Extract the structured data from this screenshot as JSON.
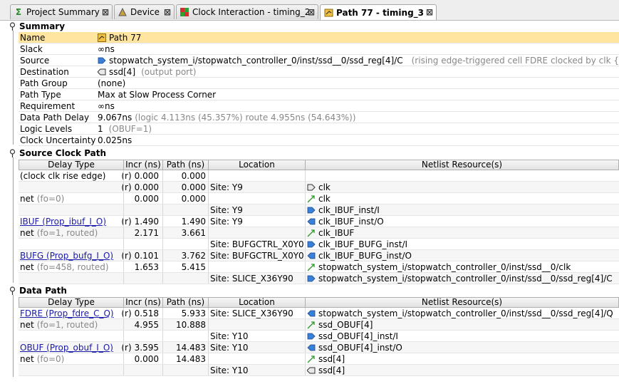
{
  "tabs": [
    {
      "label": "Project Summary",
      "icon": "sigma-icon"
    },
    {
      "label": "Device",
      "icon": "device-icon"
    },
    {
      "label": "Clock Interaction - timing_2",
      "icon": "clock-interaction-icon"
    },
    {
      "label": "Path 77 - timing_3",
      "icon": "path-icon"
    }
  ],
  "close_glyph": "⊠",
  "summary": {
    "title": "Summary",
    "rows": [
      {
        "key": "Name",
        "value": "Path 77",
        "note": ""
      },
      {
        "key": "Slack",
        "value": "∞ns",
        "note": ""
      },
      {
        "key": "Source",
        "value": "stopwatch_system_i/stopwatch_controller_0/inst/ssd__0/ssd_reg[4]/C",
        "note": "(rising edge-triggered cell FDRE clocked by clk  {rise"
      },
      {
        "key": "Destination",
        "value": "ssd[4]",
        "note": "(output port)"
      },
      {
        "key": "Path Group",
        "value": "(none)",
        "note": ""
      },
      {
        "key": "Path Type",
        "value": "Max at Slow Process Corner",
        "note": ""
      },
      {
        "key": "Requirement",
        "value": "∞ns",
        "note": ""
      },
      {
        "key": "Data Path Delay",
        "value": "9.067ns",
        "note": "(logic 4.113ns (45.357%)  route 4.955ns (54.643%))"
      },
      {
        "key": "Logic Levels",
        "value": "1",
        "note": "(OBUF=1)"
      },
      {
        "key": "Clock Uncertainty",
        "value": "0.025ns",
        "note": ""
      }
    ]
  },
  "columns": [
    "Delay Type",
    "Incr (ns)",
    "Path (ns)",
    "Location",
    "Netlist Resource(s)"
  ],
  "source_clock_path": {
    "title": "Source Clock Path",
    "rows": [
      {
        "delay_type": "(clock clk rise edge)",
        "dt_note": "",
        "link": false,
        "edge": "(r)",
        "incr": "0.000",
        "path": "0.000",
        "location": "",
        "resource": "",
        "res_icon": ""
      },
      {
        "delay_type": "",
        "dt_note": "",
        "link": false,
        "edge": "(r)",
        "incr": "0.000",
        "path": "0.000",
        "location": "Site: Y9",
        "resource": "clk",
        "res_icon": "input-port-icon"
      },
      {
        "delay_type": "net",
        "dt_note": "(fo=0)",
        "link": false,
        "edge": "",
        "incr": "0.000",
        "path": "0.000",
        "location": "",
        "resource": "clk",
        "res_icon": "net-icon"
      },
      {
        "delay_type": "",
        "dt_note": "",
        "link": false,
        "edge": "",
        "incr": "",
        "path": "",
        "location": "Site: Y9",
        "resource": "clk_IBUF_inst/I",
        "res_icon": "pin-in-icon"
      },
      {
        "delay_type": "IBUF (Prop_ibuf_I_O)",
        "dt_note": "",
        "link": true,
        "edge": "(r)",
        "incr": "1.490",
        "path": "1.490",
        "location": "Site: Y9",
        "resource": "clk_IBUF_inst/O",
        "res_icon": "pin-out-icon"
      },
      {
        "delay_type": "net",
        "dt_note": "(fo=1, routed)",
        "link": false,
        "edge": "",
        "incr": "2.171",
        "path": "3.661",
        "location": "",
        "resource": "clk_IBUF",
        "res_icon": "net-icon"
      },
      {
        "delay_type": "",
        "dt_note": "",
        "link": false,
        "edge": "",
        "incr": "",
        "path": "",
        "location": "Site: BUFGCTRL_X0Y0",
        "resource": "clk_IBUF_BUFG_inst/I",
        "res_icon": "pin-in-icon"
      },
      {
        "delay_type": "BUFG (Prop_bufg_I_O)",
        "dt_note": "",
        "link": true,
        "edge": "(r)",
        "incr": "0.101",
        "path": "3.762",
        "location": "Site: BUFGCTRL_X0Y0",
        "resource": "clk_IBUF_BUFG_inst/O",
        "res_icon": "pin-out-icon"
      },
      {
        "delay_type": "net",
        "dt_note": "(fo=458, routed)",
        "link": false,
        "edge": "",
        "incr": "1.653",
        "path": "5.415",
        "location": "",
        "resource": "stopwatch_system_i/stopwatch_controller_0/inst/ssd__0/clk",
        "res_icon": "net-icon"
      },
      {
        "delay_type": "",
        "dt_note": "",
        "link": false,
        "edge": "",
        "incr": "",
        "path": "",
        "location": "Site: SLICE_X36Y90",
        "resource": "stopwatch_system_i/stopwatch_controller_0/inst/ssd__0/ssd_reg[4]/C",
        "res_icon": "pin-in-icon"
      }
    ]
  },
  "data_path": {
    "title": "Data Path",
    "rows": [
      {
        "delay_type": "FDRE (Prop_fdre_C_Q)",
        "dt_note": "",
        "link": true,
        "edge": "(r)",
        "incr": "0.518",
        "path": "5.933",
        "location": "Site: SLICE_X36Y90",
        "resource": "stopwatch_system_i/stopwatch_controller_0/inst/ssd__0/ssd_reg[4]/Q",
        "res_icon": "pin-out-icon"
      },
      {
        "delay_type": "net",
        "dt_note": "(fo=1, routed)",
        "link": false,
        "edge": "",
        "incr": "4.955",
        "path": "10.888",
        "location": "",
        "resource": "ssd_OBUF[4]",
        "res_icon": "net-icon"
      },
      {
        "delay_type": "",
        "dt_note": "",
        "link": false,
        "edge": "",
        "incr": "",
        "path": "",
        "location": "Site: Y10",
        "resource": "ssd_OBUF[4]_inst/I",
        "res_icon": "pin-in-icon"
      },
      {
        "delay_type": "OBUF (Prop_obuf_I_O)",
        "dt_note": "",
        "link": true,
        "edge": "(r)",
        "incr": "3.595",
        "path": "14.483",
        "location": "Site: Y10",
        "resource": "ssd_OBUF[4]_inst/O",
        "res_icon": "pin-out-icon"
      },
      {
        "delay_type": "net",
        "dt_note": "(fo=0)",
        "link": false,
        "edge": "",
        "incr": "0.000",
        "path": "14.483",
        "location": "",
        "resource": "ssd[4]",
        "res_icon": "net-icon"
      },
      {
        "delay_type": "",
        "dt_note": "",
        "link": false,
        "edge": "",
        "incr": "",
        "path": "",
        "location": "Site: Y10",
        "resource": "ssd[4]",
        "res_icon": "output-port-icon"
      }
    ]
  }
}
